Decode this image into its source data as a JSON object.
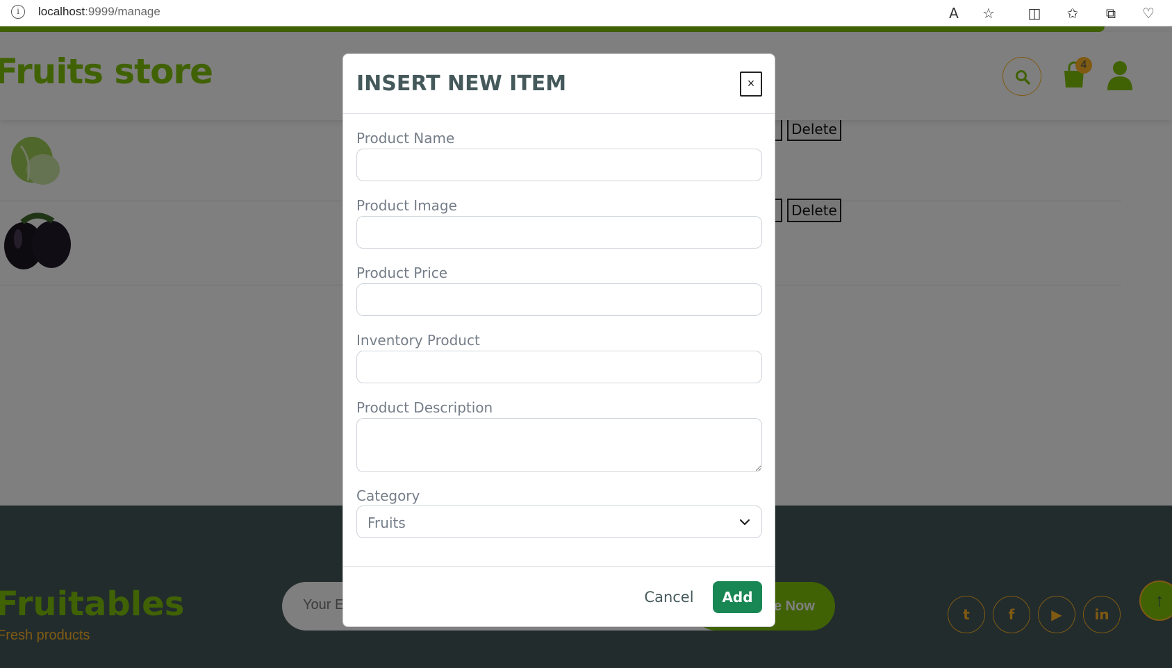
{
  "browser": {
    "url_host": "localhost",
    "url_rest": ":9999/manage",
    "icons": [
      "read-aloud-icon",
      "favorite-star-icon",
      "split-screen-icon",
      "favorites-icon",
      "collections-icon",
      "browser-essentials-icon"
    ]
  },
  "header": {
    "brand": "Fruits store",
    "cart_count": "4"
  },
  "table": {
    "rows": [
      {
        "delete_label": "Delete"
      },
      {
        "delete_label": "Delete"
      }
    ]
  },
  "footer": {
    "brand": "Fruitables",
    "tagline": "Fresh products",
    "email_placeholder": "Your E",
    "subscribe_label": "e Now",
    "social": [
      "twitter-icon",
      "facebook-icon",
      "youtube-icon",
      "linkedin-icon"
    ]
  },
  "modal": {
    "title": "INSERT NEW ITEM",
    "close_label": "×",
    "fields": {
      "name_label": "Product Name",
      "name_value": "",
      "image_label": "Product Image",
      "image_value": "",
      "price_label": "Product Price",
      "price_value": "",
      "inventory_label": "Inventory Product",
      "inventory_value": "",
      "description_label": "Product Description",
      "description_value": "",
      "category_label": "Category",
      "category_value": "Fruits"
    },
    "cancel_label": "Cancel",
    "add_label": "Add"
  },
  "colors": {
    "brand_green": "#81c408",
    "accent_orange": "#ffb524",
    "dark_slate": "#45595b",
    "add_button": "#198754"
  }
}
